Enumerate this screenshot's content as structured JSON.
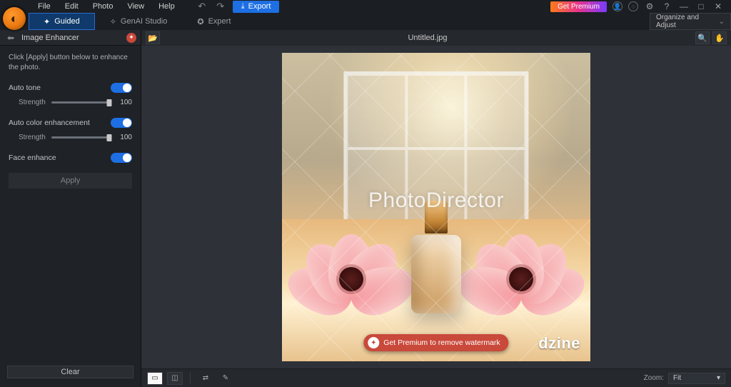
{
  "menu": {
    "file": "File",
    "edit": "Edit",
    "photo": "Photo",
    "view": "View",
    "help": "Help"
  },
  "toolbar": {
    "export": "Export",
    "get_premium": "Get Premium"
  },
  "modes": {
    "guided": "Guided",
    "genai": "GenAI Studio",
    "expert": "Expert",
    "dropdown": "Organize and Adjust"
  },
  "panel": {
    "title": "Image Enhancer",
    "instruction": "Click [Apply] button below to enhance the photo.",
    "auto_tone": "Auto tone",
    "auto_color": "Auto color enhancement",
    "face_enhance": "Face enhance",
    "strength": "Strength",
    "strength_val_1": "100",
    "strength_val_2": "100",
    "apply": "Apply",
    "clear": "Clear"
  },
  "canvas": {
    "filename": "Untitled.jpg",
    "watermark_text": "PhotoDirector",
    "watermark_pill": "Get Premium to remove watermark",
    "brand_logo": "dzine"
  },
  "footer": {
    "zoom_label": "Zoom:",
    "zoom_value": "Fit"
  },
  "icons": {
    "undo": "↶",
    "redo": "↷",
    "export": "⤓",
    "user": "👤",
    "bell": "◌",
    "gear": "⚙",
    "help": "?",
    "min": "—",
    "max": "□",
    "close": "✕",
    "guided": "✦",
    "genai": "✧",
    "expert": "✪",
    "chev": "⌄",
    "back": "⬅",
    "folder": "📂",
    "zoomtool": "🔍",
    "hand": "✋",
    "view1": "▭",
    "view2": "◫",
    "compare": "⇄",
    "wand": "✎"
  }
}
